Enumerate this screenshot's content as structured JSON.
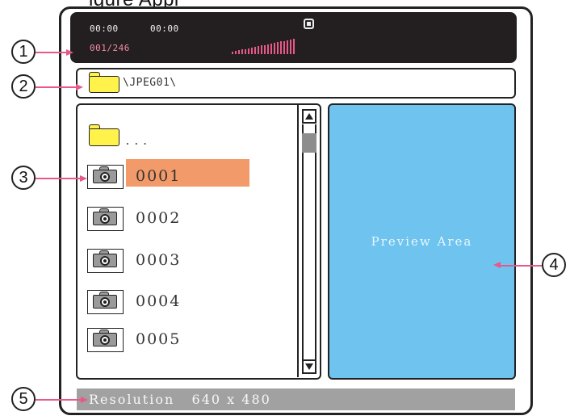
{
  "caption_partial": "igure Appl",
  "status": {
    "elapsed": "00:00",
    "total": "00:00",
    "track_counter": "001/246",
    "volume_bars": 20,
    "stop_icon": "stop-icon"
  },
  "path": {
    "folder_icon": "folder-icon",
    "text": "\\JPEG01\\"
  },
  "file_list": {
    "parent_label": "...",
    "items": [
      {
        "name": "0001",
        "selected": true
      },
      {
        "name": "0002",
        "selected": false
      },
      {
        "name": "0003",
        "selected": false
      },
      {
        "name": "0004",
        "selected": false
      },
      {
        "name": "0005",
        "selected": false
      }
    ]
  },
  "preview": {
    "label": "Preview Area"
  },
  "resolution": {
    "label": "Resolution",
    "value": "640 x 480"
  },
  "callouts": [
    "1",
    "2",
    "3",
    "4",
    "5"
  ],
  "colors": {
    "status_bg": "#231f20",
    "highlight": "#f29a6a",
    "preview_bg": "#6ec3ef",
    "resolution_bg": "#a1a1a1",
    "callout_leader": "#e8588a",
    "folder": "#fff24a"
  }
}
